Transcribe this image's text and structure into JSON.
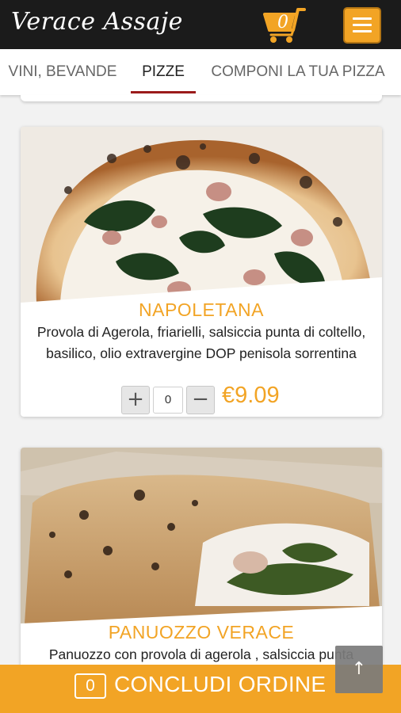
{
  "header": {
    "logo_text": "Verace Assaje",
    "cart_count": "0",
    "menu_icon": "hamburger-icon",
    "cart_icon": "cart-icon"
  },
  "tabs": [
    {
      "label": "VINI, BEVANDE",
      "active": false
    },
    {
      "label": "PIZZE",
      "active": true
    },
    {
      "label": "COMPONI LA TUA PIZZA",
      "active": false
    }
  ],
  "products": [
    {
      "name": "NAPOLETANA",
      "description": "Provola di Agerola, friarielli, salsiccia punta di coltello, basilico, olio extravergine DOP penisola sorrentina",
      "quantity": "0",
      "price": "€9.09",
      "plus_label": "+",
      "minus_label": "−"
    },
    {
      "name": "PANUOZZO VERACE",
      "description": "Panuozzo con provola di agerola , salsiccia punta"
    }
  ],
  "footer": {
    "order_count": "0",
    "order_label": "CONCLUDI ORDINE",
    "scroll_top_icon": "arrow-up-icon"
  },
  "colors": {
    "accent": "#f2a425",
    "header_bg": "#1b1b1b",
    "tab_indicator": "#9b1b1b"
  }
}
